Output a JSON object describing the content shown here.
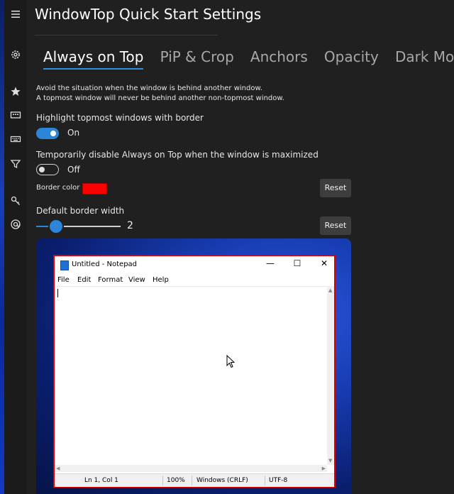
{
  "window": {
    "title": "WindowTop Quick Start Settings"
  },
  "tabs": [
    {
      "label": "Always on Top",
      "active": true
    },
    {
      "label": "PiP & Crop"
    },
    {
      "label": "Anchors"
    },
    {
      "label": "Opacity"
    },
    {
      "label": "Dark Mode"
    },
    {
      "label": "M"
    }
  ],
  "description": {
    "line1": "Avoid the situation when the window is behind another window.",
    "line2": "A topmost window will never be behind another non-topmost window."
  },
  "settings": {
    "highlight": {
      "label": "Highlight topmost windows with border",
      "state_label": "On",
      "on": true
    },
    "disable_maximized": {
      "label": "Temporarily disable Always on Top when the window is maximized",
      "state_label": "Off",
      "on": false
    },
    "border_color": {
      "label": "Border color",
      "color": "#ff0000",
      "reset_label": "Reset"
    },
    "border_width": {
      "label": "Default border width",
      "value": "2",
      "reset_label": "Reset"
    }
  },
  "sidebar": {
    "icons": [
      "menu-icon",
      "settings-icon",
      "star-icon",
      "window-icon",
      "keyboard-icon",
      "filter-icon",
      "key-icon",
      "at-icon"
    ]
  },
  "notepad": {
    "title": "Untitled - Notepad",
    "menu": [
      "File",
      "Edit",
      "Format",
      "View",
      "Help"
    ],
    "controls": {
      "minimize": "—",
      "maximize": "☐",
      "close": "✕"
    },
    "status": {
      "position": "Ln 1, Col 1",
      "zoom": "100%",
      "line_ending": "Windows (CRLF)",
      "encoding": "UTF-8"
    }
  },
  "colors": {
    "accent": "#2b86d9",
    "border_highlight": "#ff0000",
    "background": "#202020"
  }
}
